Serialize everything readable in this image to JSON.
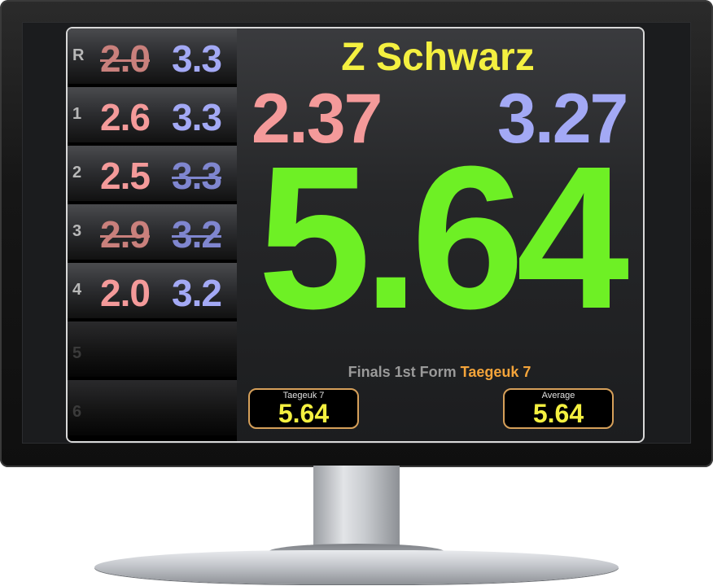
{
  "competitor": {
    "name": "Z Schwarz"
  },
  "rounds": [
    {
      "label": "R",
      "red": "2.0",
      "blue": "3.3",
      "red_struck": true,
      "blue_struck": false
    },
    {
      "label": "1",
      "red": "2.6",
      "blue": "3.3",
      "red_struck": false,
      "blue_struck": false
    },
    {
      "label": "2",
      "red": "2.5",
      "blue": "3.3",
      "red_struck": false,
      "blue_struck": true
    },
    {
      "label": "3",
      "red": "2.9",
      "blue": "3.2",
      "red_struck": true,
      "blue_struck": true
    },
    {
      "label": "4",
      "red": "2.0",
      "blue": "3.2",
      "red_struck": false,
      "blue_struck": false
    },
    {
      "label": "5"
    },
    {
      "label": "6"
    }
  ],
  "scores": {
    "red_avg": "2.37",
    "blue_avg": "3.27",
    "total": "5.64"
  },
  "form": {
    "prefix": "Finals 1st Form",
    "name": "Taegeuk 7"
  },
  "badges": {
    "form_score": {
      "label": "Taegeuk 7",
      "value": "5.64"
    },
    "average": {
      "label": "Average",
      "value": "5.64"
    }
  },
  "colors": {
    "accuracy_red": "#f49a9a",
    "presentation_blue": "#a3a9f5",
    "total_green": "#6ef025",
    "name_yellow": "#f4f040",
    "form_orange": "#f4a43a"
  }
}
